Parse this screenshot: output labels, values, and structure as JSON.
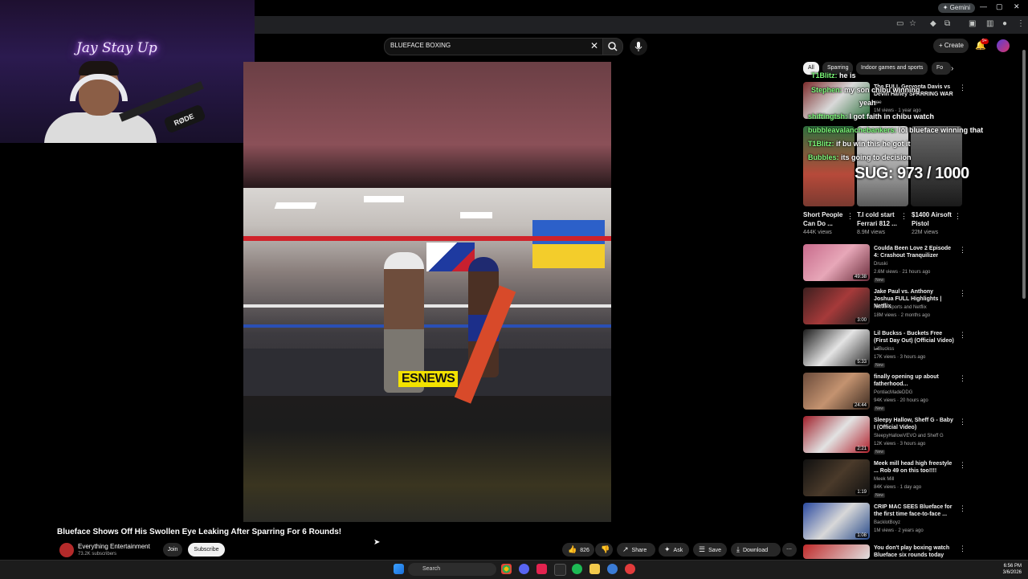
{
  "browser": {
    "gemini_label": "Gemini",
    "colors": {
      "bg": "#000000",
      "toolbar": "#202124"
    }
  },
  "header": {
    "search_value": "BLUEFACE BOXING",
    "create_label": "Create",
    "notification_count": "9+"
  },
  "webcam": {
    "neon_sign": "Jay Stay Up",
    "mic_brand": "RØDE"
  },
  "player": {
    "watermark": "ESNEWS"
  },
  "video": {
    "title": "Blueface Shows Off His Swollen Eye Leaking After Sparring For 6 Rounds!",
    "channel": "Everything Entertainment",
    "subscribers": "73.2K subscribers",
    "join_label": "Join",
    "subscribe_label": "Subscribe",
    "likes": "826",
    "share_label": "Share",
    "ask_label": "Ask",
    "save_label": "Save",
    "download_label": "Download"
  },
  "sidebar": {
    "chips": [
      "All",
      "Sparring",
      "Indoor games and sports",
      "Fo"
    ],
    "top_video": {
      "title": "The FULL Gervonta Davis vs Devin Haney SPARRING WAR -...",
      "channel": "ype",
      "meta": "1M views · 1 year ago"
    },
    "shorts": [
      {
        "title": "Short People Can Do ...",
        "views": "444K views"
      },
      {
        "title": "T.I cold start Ferrari 812 ...",
        "views": "8.9M views"
      },
      {
        "title": "$1400 Airsoft Pistol",
        "views": "22M views"
      }
    ],
    "recommendations": [
      {
        "title": "Coulda Been Love 2 Episode 4: Crashout Tranquilizer",
        "channel": "Druski",
        "meta": "2.6M views · 21 hours ago",
        "badge": "New",
        "duration": "49:38"
      },
      {
        "title": "Jake Paul vs. Anthony Joshua FULL Highlights | Netflix",
        "channel": "Netflix Sports and Netflix",
        "meta": "18M views · 2 months ago",
        "badge": "",
        "duration": "3:00"
      },
      {
        "title": "Lil Buckss - Buckets Free (First Day Out) (Official Video) ...",
        "channel": "LilBuckss",
        "meta": "17K views · 3 hours ago",
        "badge": "New",
        "duration": "5:33"
      },
      {
        "title": "finally opening up about fatherhood...",
        "channel": "PontiacMadeDDG",
        "meta": "94K views · 20 hours ago",
        "badge": "New",
        "duration": "24:44"
      },
      {
        "title": "Sleepy Hallow, Sheff G - Baby I (Official Video)",
        "channel": "SleepyHallowVEVO and Sheff G",
        "meta": "12K views · 3 hours ago",
        "badge": "New",
        "duration": "2:21"
      },
      {
        "title": "Meek mill head high freestyle ... Rob 49 on this too!!!!",
        "channel": "Meek Mill",
        "meta": "84K views · 1 day ago",
        "badge": "New",
        "duration": "1:19"
      },
      {
        "title": "CRIP MAC SEES Blueface for the first time face-to-face ...",
        "channel": "BacklotBoyz",
        "meta": "1M views · 2 years ago",
        "badge": "",
        "duration": "1:08"
      },
      {
        "title": "You don't play boxing watch Blueface six rounds today",
        "channel": "",
        "meta": "",
        "badge": "",
        "duration": ""
      }
    ]
  },
  "chat_overlay": {
    "messages": [
      {
        "user": "T1Blitz:",
        "text": "he is"
      },
      {
        "user": "Stephen:",
        "text": "my son chibu winning"
      },
      {
        "user": "",
        "text": "yeah"
      },
      {
        "user": "shiftingtsh:",
        "text": "I got faith in chibu watch"
      },
      {
        "user": "bubbleavalanchebankers:",
        "text": "lol blueface winning that"
      },
      {
        "user": "T1Blitz:",
        "text": "if bu win this he got it"
      },
      {
        "user": "Bubbles:",
        "text": "its going to decision"
      }
    ],
    "counter": "SUG: 973 / 1000"
  },
  "taskbar": {
    "search_placeholder": "Search",
    "time": "6:56 PM",
    "date": "3/6/2026"
  }
}
